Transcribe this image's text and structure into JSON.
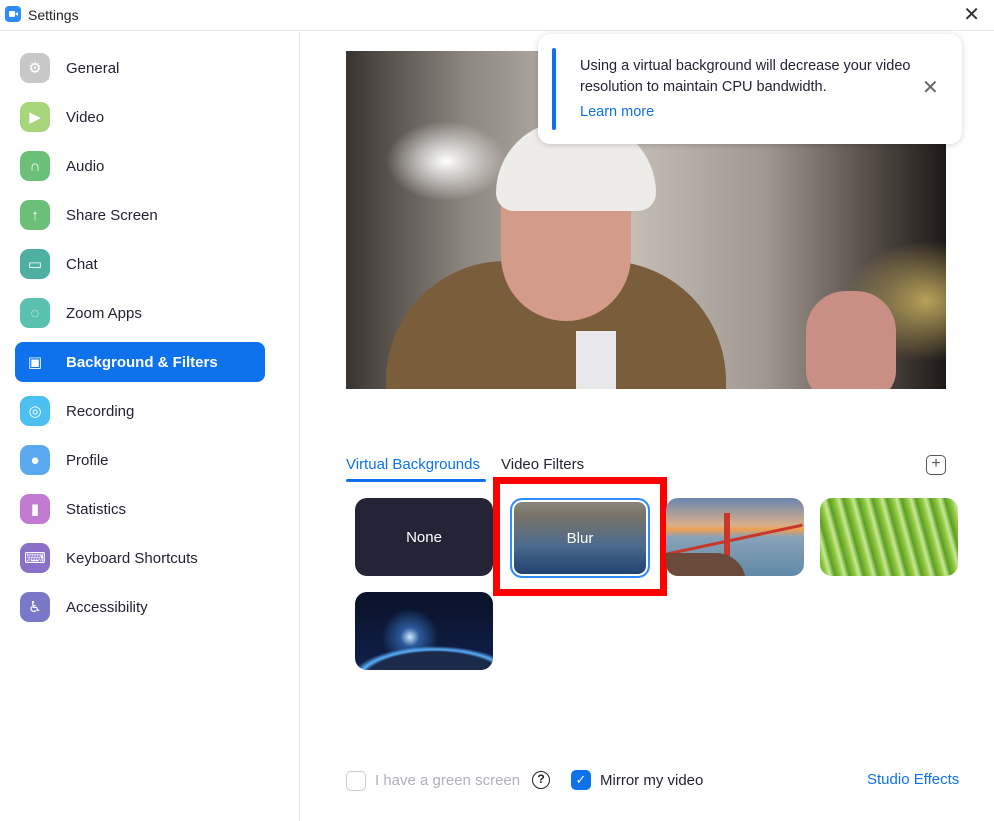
{
  "window": {
    "title": "Settings",
    "close_glyph": "✕"
  },
  "sidebar": {
    "items": [
      {
        "label": "General",
        "icon": "gear-icon",
        "glyph": "⚙",
        "color": "#c8c8c8",
        "active": false
      },
      {
        "label": "Video",
        "icon": "video-camera-icon",
        "glyph": "▶",
        "color": "#a6d57a",
        "active": false
      },
      {
        "label": "Audio",
        "icon": "headphones-icon",
        "glyph": "∩",
        "color": "#6cbf78",
        "active": false
      },
      {
        "label": "Share Screen",
        "icon": "share-screen-icon",
        "glyph": "↑",
        "color": "#6cbf78",
        "active": false
      },
      {
        "label": "Chat",
        "icon": "chat-icon",
        "glyph": "▭",
        "color": "#4db0a0",
        "active": false
      },
      {
        "label": "Zoom Apps",
        "icon": "apps-icon",
        "glyph": "◌",
        "color": "#5ac0b0",
        "active": false
      },
      {
        "label": "Background & Filters",
        "icon": "background-icon",
        "glyph": "▣",
        "color": "#0e72ed",
        "active": true
      },
      {
        "label": "Recording",
        "icon": "record-icon",
        "glyph": "◎",
        "color": "#4cc0f0",
        "active": false
      },
      {
        "label": "Profile",
        "icon": "profile-icon",
        "glyph": "●",
        "color": "#5aaaf0",
        "active": false
      },
      {
        "label": "Statistics",
        "icon": "statistics-icon",
        "glyph": "▮",
        "color": "#c07ad0",
        "active": false
      },
      {
        "label": "Keyboard Shortcuts",
        "icon": "keyboard-icon",
        "glyph": "⌨",
        "color": "#8a70c8",
        "active": false
      },
      {
        "label": "Accessibility",
        "icon": "accessibility-icon",
        "glyph": "♿",
        "color": "#7a78c8",
        "active": false
      }
    ]
  },
  "toast": {
    "message": "Using a virtual background will decrease your video resolution to maintain CPU bandwidth.",
    "link": "Learn more",
    "close_glyph": "✕"
  },
  "tabs": [
    {
      "label": "Virtual Backgrounds",
      "active": true
    },
    {
      "label": "Video Filters",
      "active": false
    }
  ],
  "add_glyph": "+",
  "backgrounds": [
    {
      "label": "None",
      "type": "none",
      "selected": false
    },
    {
      "label": "Blur",
      "type": "blur",
      "selected": true
    },
    {
      "label": "",
      "type": "golden-gate-bridge",
      "selected": false
    },
    {
      "label": "",
      "type": "grass",
      "selected": false
    },
    {
      "label": "",
      "type": "earth-from-space",
      "selected": false
    }
  ],
  "footer": {
    "green_screen_label": "I have a green screen",
    "green_screen_checked": false,
    "help_glyph": "?",
    "mirror_label": "Mirror my video",
    "mirror_checked": true,
    "check_glyph": "✓",
    "studio_effects": "Studio Effects"
  }
}
